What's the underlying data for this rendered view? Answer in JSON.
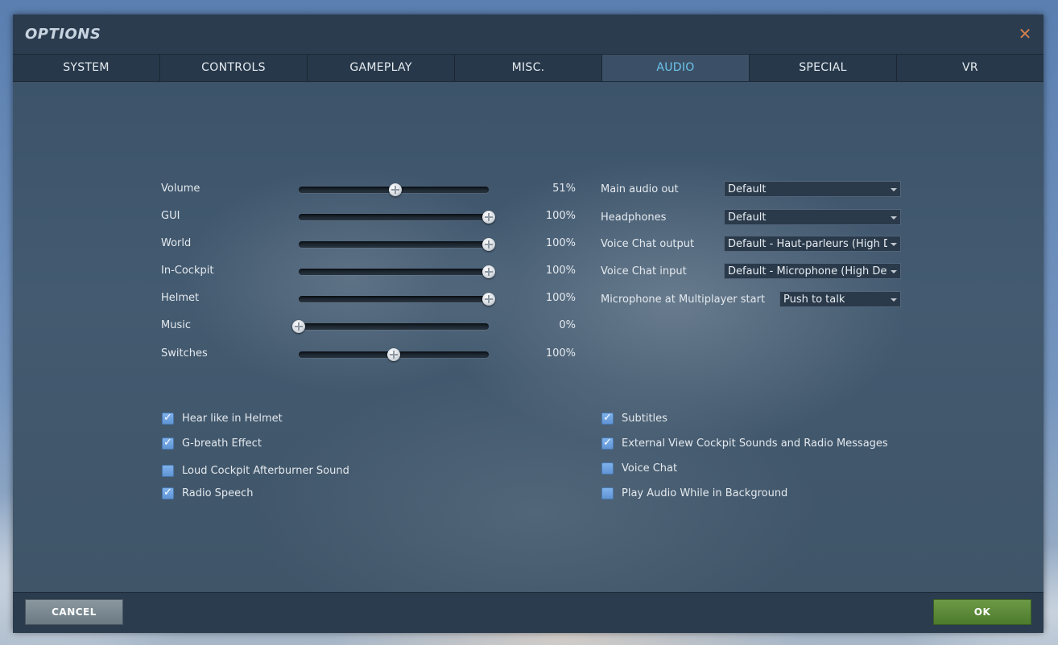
{
  "window": {
    "title": "OPTIONS",
    "close_symbol": "✕"
  },
  "tabs": [
    {
      "label": "SYSTEM"
    },
    {
      "label": "CONTROLS"
    },
    {
      "label": "GAMEPLAY"
    },
    {
      "label": "MISC."
    },
    {
      "label": "AUDIO",
      "active": true
    },
    {
      "label": "SPECIAL"
    },
    {
      "label": "VR"
    }
  ],
  "sliders": [
    {
      "label": "Volume",
      "value_text": "51%",
      "fraction": 0.51
    },
    {
      "label": "GUI",
      "value_text": "100%",
      "fraction": 1.0
    },
    {
      "label": "World",
      "value_text": "100%",
      "fraction": 1.0
    },
    {
      "label": "In-Cockpit",
      "value_text": "100%",
      "fraction": 1.0
    },
    {
      "label": "Helmet",
      "value_text": "100%",
      "fraction": 1.0
    },
    {
      "label": "Music",
      "value_text": "0%",
      "fraction": 0.0
    },
    {
      "label": "Switches",
      "value_text": "100%",
      "fraction": 0.5
    }
  ],
  "dropdowns": [
    {
      "label": "Main audio out",
      "value": "Default"
    },
    {
      "label": "Headphones",
      "value": "Default"
    },
    {
      "label": "Voice Chat output",
      "value": "Default - Haut-parleurs (High Definition Audio)"
    },
    {
      "label": "Voice Chat input",
      "value": "Default - Microphone (High Definition Audio)"
    },
    {
      "label": "Microphone at Multiplayer start",
      "value": "Push to talk"
    }
  ],
  "checkboxes_left": [
    {
      "label": "Hear like in Helmet",
      "checked": true
    },
    {
      "label": "G-breath Effect",
      "checked": true
    },
    {
      "label": "Loud Cockpit Afterburner Sound",
      "checked": false
    },
    {
      "label": "Radio Speech",
      "checked": true
    }
  ],
  "checkboxes_right": [
    {
      "label": "Subtitles",
      "checked": true
    },
    {
      "label": "External View Cockpit Sounds and Radio Messages",
      "checked": true
    },
    {
      "label": "Voice Chat",
      "checked": false
    },
    {
      "label": "Play Audio While in Background",
      "checked": false
    }
  ],
  "check_glyph": "✓",
  "footer": {
    "cancel_label": "CANCEL",
    "ok_label": "OK"
  },
  "colors": {
    "active_tab": "#6cc4ee",
    "ok_button": "#5a8b39",
    "checkbox": "#6fa3e0"
  }
}
